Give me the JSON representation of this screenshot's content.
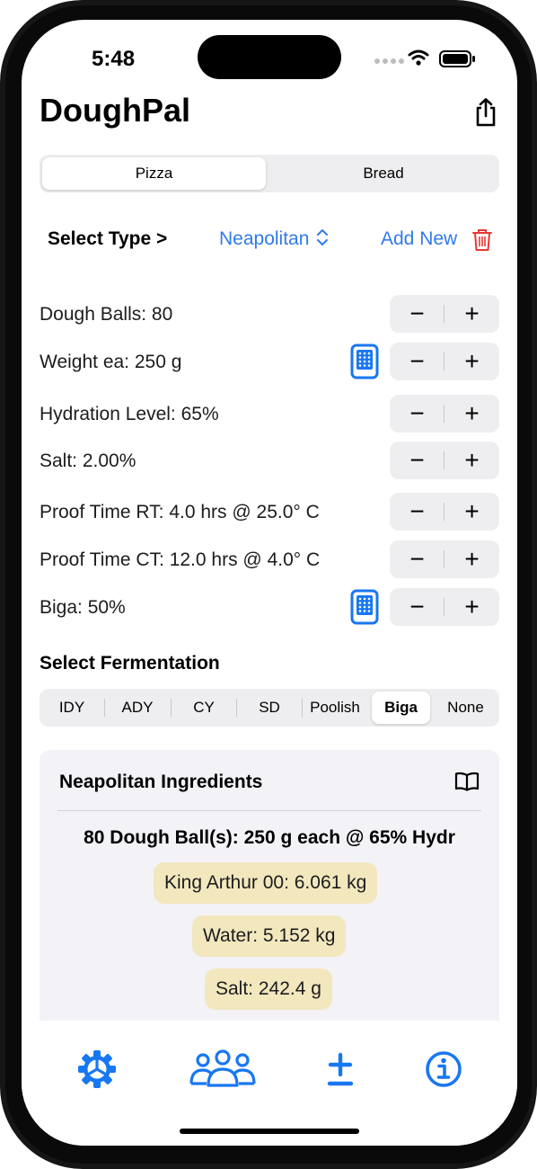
{
  "status": {
    "time": "5:48"
  },
  "app": {
    "title": "DoughPal"
  },
  "mode_tabs": [
    {
      "label": "Pizza",
      "active": true
    },
    {
      "label": "Bread",
      "active": false
    }
  ],
  "type_selector": {
    "label": "Select Type >",
    "value": "Neapolitan",
    "add_new": "Add New"
  },
  "rows": [
    {
      "label": "Dough Balls: 80"
    },
    {
      "label": "Weight ea: 250 g"
    },
    {
      "label": "Hydration Level: 65%"
    },
    {
      "label": "Salt: 2.00%"
    },
    {
      "label": "Proof Time RT: 4.0 hrs @ 25.0° C"
    },
    {
      "label": "Proof Time CT: 12.0 hrs @ 4.0° C"
    },
    {
      "label": "Biga: 50%"
    }
  ],
  "stepper": {
    "minus": "−",
    "plus": "+"
  },
  "fermentation": {
    "title": "Select Fermentation",
    "options": [
      "IDY",
      "ADY",
      "CY",
      "SD",
      "Poolish",
      "Biga",
      "None"
    ],
    "selected": "Biga"
  },
  "ingredients": {
    "title": "Neapolitan Ingredients",
    "summary": "80 Dough Ball(s): 250 g each @ 65% Hydr",
    "items": [
      "King Arthur 00: 6.061 kg",
      "Water: 5.152 kg",
      "Salt: 242.4 g"
    ]
  },
  "tabbar": {
    "icons": [
      "gear-icon",
      "people-icon",
      "plus-minus-icon",
      "info-icon"
    ]
  },
  "colors": {
    "accent": "#2f7be8",
    "tab_accent": "#1877f2",
    "trash": "#e53935",
    "pill": "#f3e7be"
  }
}
